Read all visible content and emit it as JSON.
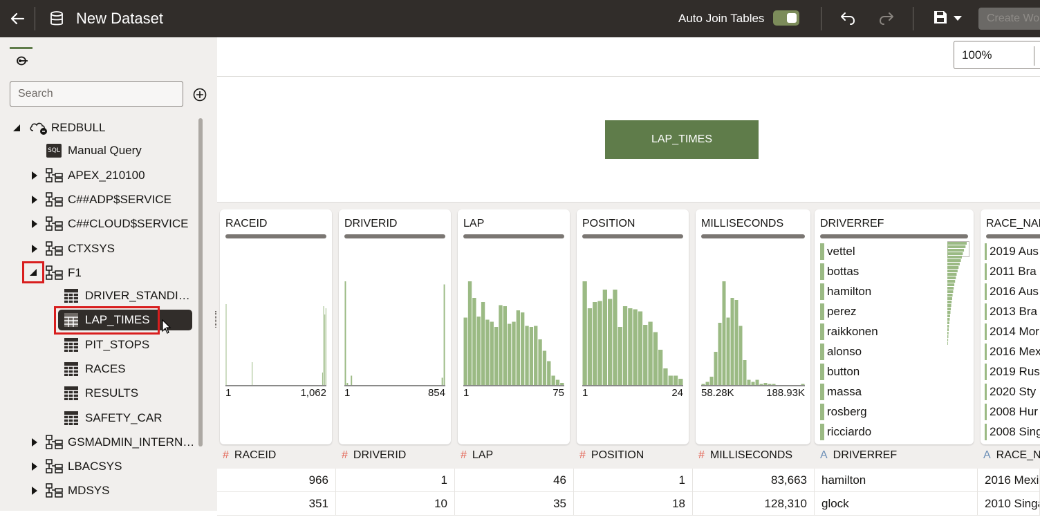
{
  "header": {
    "title": "New Dataset",
    "auto_join_label": "Auto Join Tables",
    "auto_join_on": true,
    "create_button": "Create Wo"
  },
  "sidebar": {
    "search_placeholder": "Search",
    "tree": {
      "root": "REDBULL",
      "manual_query": "Manual Query",
      "schemas": [
        "APEX_210100",
        "C##ADP$SERVICE",
        "C##CLOUD$SERVICE",
        "CTXSYS",
        "F1"
      ],
      "f1_tables": [
        "DRIVER_STANDI…",
        "LAP_TIMES",
        "PIT_STOPS",
        "RACES",
        "RESULTS",
        "SAFETY_CAR"
      ],
      "more_schemas": [
        "GSMADMIN_INTERN…",
        "LBACSYS",
        "MDSYS"
      ],
      "selected": "LAP_TIMES"
    }
  },
  "canvas": {
    "zoom": "100%",
    "node_label": "LAP_TIMES"
  },
  "columns": {
    "raceid": {
      "name": "RACEID",
      "min": "1",
      "max": "1,062",
      "type": "#"
    },
    "driverid": {
      "name": "DRIVERID",
      "min": "1",
      "max": "854",
      "type": "#"
    },
    "lap": {
      "name": "LAP",
      "min": "1",
      "max": "75",
      "type": "#"
    },
    "position": {
      "name": "POSITION",
      "min": "1",
      "max": "24",
      "type": "#"
    },
    "milliseconds": {
      "name": "MILLISECONDS",
      "min": "58.28K",
      "max": "188.93K",
      "type": "#"
    },
    "driverref": {
      "name": "DRIVERREF",
      "type": "A",
      "values": [
        "vettel",
        "bottas",
        "hamilton",
        "perez",
        "raikkonen",
        "alonso",
        "button",
        "massa",
        "rosberg",
        "ricciardo"
      ]
    },
    "race_name": {
      "name": "RACE_NAM",
      "header": "RACE_N",
      "type": "A",
      "values": [
        "2019 Aus",
        "2011 Bra",
        "2016 Aus",
        "2013 Bra",
        "2014 Mor",
        "2016 Mex",
        "2019 Rus",
        "2020 Sty",
        "2008 Hur",
        "2008 Sing"
      ]
    }
  },
  "chart_data": [
    {
      "type": "bar",
      "title": "RACEID",
      "x_range": [
        "1",
        "1,062"
      ],
      "values": [
        78,
        0,
        0,
        0,
        0,
        0,
        0,
        0,
        0,
        0,
        0,
        0,
        0,
        0,
        0,
        0,
        0,
        0,
        0,
        0,
        0,
        0,
        0,
        22,
        0,
        0,
        0,
        0,
        0,
        0,
        0,
        0,
        0,
        0,
        0,
        0,
        0,
        0,
        0,
        0,
        0,
        0,
        0,
        0,
        0,
        0,
        0,
        0,
        0,
        0,
        0,
        0,
        0,
        0,
        0,
        0,
        0,
        0,
        0,
        0,
        0,
        0,
        0,
        0,
        0,
        0,
        0,
        0,
        0,
        0,
        0,
        0,
        0,
        0,
        0,
        0,
        0,
        0,
        0,
        0,
        0,
        0,
        0,
        0,
        0,
        12,
        76,
        68,
        74
      ]
    },
    {
      "type": "bar",
      "title": "DRIVERID",
      "x_range": [
        "1",
        "854"
      ],
      "values": [
        100,
        2,
        0,
        9,
        0,
        0,
        0,
        0,
        0,
        0,
        0,
        0,
        0,
        0,
        0,
        0,
        0,
        0,
        0,
        0,
        0,
        0,
        0,
        0,
        0,
        0,
        0,
        0,
        0,
        0,
        0,
        0,
        0,
        0,
        0,
        0,
        0,
        0,
        0,
        0,
        0,
        0,
        0,
        0,
        0,
        0,
        0,
        0,
        7,
        97
      ]
    },
    {
      "type": "bar",
      "title": "LAP",
      "x_range": [
        "1",
        "75"
      ],
      "values": [
        65,
        100,
        84,
        66,
        80,
        63,
        61,
        56,
        77,
        76,
        59,
        61,
        72,
        70,
        57,
        56,
        57,
        44,
        33,
        23,
        9,
        5,
        2
      ]
    },
    {
      "type": "bar",
      "title": "POSITION",
      "x_range": [
        "1",
        "24"
      ],
      "values": [
        100,
        74,
        80,
        81,
        92,
        83,
        92,
        56,
        76,
        74,
        73,
        71,
        58,
        61,
        51,
        34,
        16,
        9,
        9,
        6
      ]
    },
    {
      "type": "bar",
      "title": "MILLISECONDS",
      "x_range": [
        "58.28K",
        "188.93K"
      ],
      "values": [
        1,
        3,
        8,
        32,
        60,
        100,
        65,
        84,
        82,
        57,
        24,
        5,
        3,
        5,
        1,
        2,
        1,
        1,
        0,
        0,
        0,
        0,
        0,
        0,
        1
      ]
    },
    {
      "type": "bar",
      "title": "DRIVERREF",
      "orientation": "horizontal",
      "values": [
        100,
        94,
        86,
        80,
        75,
        70,
        64,
        58,
        53,
        48,
        44,
        40,
        36,
        33,
        30,
        27,
        25,
        22,
        20,
        18,
        16,
        14,
        12,
        10,
        8,
        7,
        6,
        5,
        4,
        3
      ]
    }
  ],
  "table_rows": [
    {
      "raceid": "966",
      "driverid": "1",
      "lap": "46",
      "position": "1",
      "milliseconds": "83,663",
      "driverref": "hamilton",
      "race_name": "2016 Mexi"
    },
    {
      "raceid": "351",
      "driverid": "10",
      "lap": "35",
      "position": "18",
      "milliseconds": "128,310",
      "driverref": "glock",
      "race_name": "2010 Singa"
    }
  ]
}
